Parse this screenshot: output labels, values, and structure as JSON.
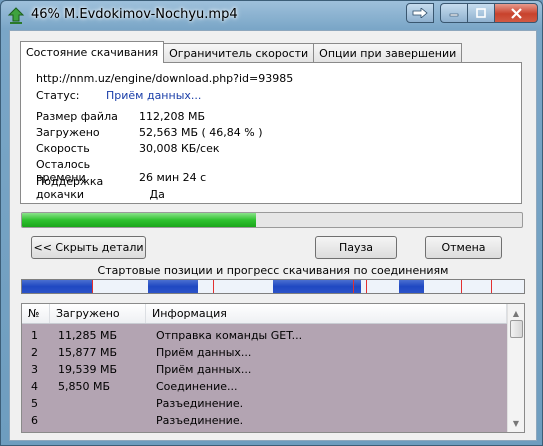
{
  "window": {
    "title": "46% M.Evdokimov-Nochyu.mp4"
  },
  "tabs": [
    {
      "label": "Состояние скачивания"
    },
    {
      "label": "Ограничитель скорости"
    },
    {
      "label": "Опции при завершении"
    }
  ],
  "status_panel": {
    "url": "http://nnm.uz/engine/download.php?id=93985",
    "status_label": "Статус:",
    "status_value": "Приём данных...",
    "rows": [
      {
        "label": "Размер файла",
        "value": "112,208  МБ"
      },
      {
        "label": "Загружено",
        "value": "52,563  МБ  ( 46,84 % )"
      },
      {
        "label": "Скорость",
        "value": "30,008  КБ/сек"
      },
      {
        "label": "Осталось времени",
        "value": "26 мин 24 с"
      },
      {
        "label": "Поддержка докачки",
        "value": "   Да"
      }
    ]
  },
  "progress": {
    "fraction": 0.4684
  },
  "buttons": {
    "hide_details": "<< Скрыть детали",
    "pause": "Пауза",
    "cancel": "Отмена"
  },
  "connections": {
    "title": "Стартовые позиции и прогресс скачивания по соединениям",
    "downloaded_segments": [
      [
        0.0,
        0.14
      ],
      [
        0.25,
        0.35
      ],
      [
        0.5,
        0.675
      ],
      [
        0.75,
        0.8
      ]
    ],
    "start_marks": [
      0.14,
      0.38,
      0.66,
      0.685,
      0.875,
      0.935
    ]
  },
  "list": {
    "headers": [
      "№",
      "Загружено",
      "Информация"
    ],
    "rows": [
      {
        "n": "1",
        "loaded": "11,285  МБ",
        "info": "Отправка команды GET..."
      },
      {
        "n": "2",
        "loaded": "15,877  МБ",
        "info": "Приём данных..."
      },
      {
        "n": "3",
        "loaded": "19,539  МБ",
        "info": "Приём данных..."
      },
      {
        "n": "4",
        "loaded": "5,850  МБ",
        "info": "Соединение..."
      },
      {
        "n": "5",
        "loaded": "",
        "info": "Разъединение."
      },
      {
        "n": "6",
        "loaded": "",
        "info": "Разъединение."
      }
    ]
  },
  "icons": {
    "app": "download-arrow-icon",
    "side": "arrow-right-icon",
    "min": "minimize-icon",
    "max": "maximize-icon",
    "close": "close-icon",
    "scroll_up": "chevron-up-icon",
    "scroll_down": "chevron-down-icon"
  }
}
